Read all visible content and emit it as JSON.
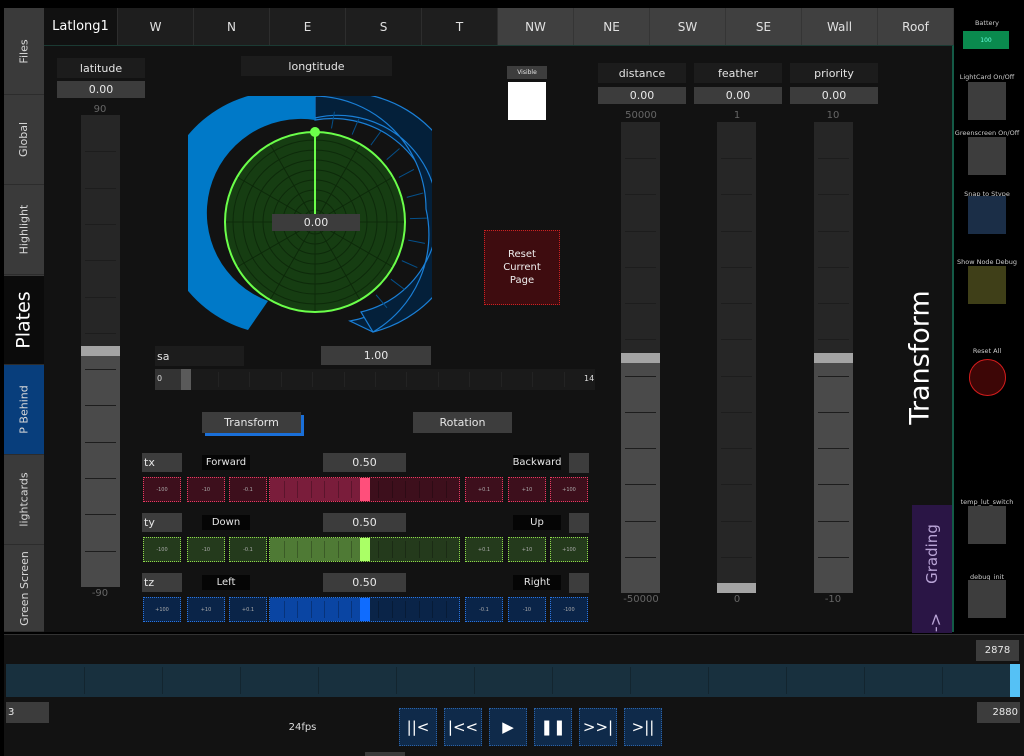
{
  "sidebar": {
    "tabs": [
      {
        "label": "Files"
      },
      {
        "label": "Global"
      },
      {
        "label": "Highlight"
      },
      {
        "label": "Plates",
        "selected": true
      },
      {
        "label": "P Behind",
        "active": true
      },
      {
        "label": "lightcards"
      },
      {
        "label": "Green Screen"
      }
    ]
  },
  "tabs": [
    {
      "label": "Latlong1",
      "selected": true
    },
    {
      "label": "W"
    },
    {
      "label": "N"
    },
    {
      "label": "E"
    },
    {
      "label": "S"
    },
    {
      "label": "T"
    },
    {
      "label": "NW"
    },
    {
      "label": "NE"
    },
    {
      "label": "SW"
    },
    {
      "label": "SE"
    },
    {
      "label": "Wall"
    },
    {
      "label": "Roof"
    }
  ],
  "latitude": {
    "label": "latitude",
    "value": "0.00",
    "max": "90",
    "min": "-90",
    "fraction": 0.5
  },
  "longitude": {
    "label": "longtitude",
    "value": "0.00",
    "angle_deg": 0
  },
  "visible": {
    "label": "Visible",
    "checked": true
  },
  "reset_page": {
    "label": "Reset Current Page",
    "line1": "Reset",
    "line2": "Current",
    "line3": "Page"
  },
  "sliders": [
    {
      "label": "distance",
      "value": "0.00",
      "max": "50000",
      "min": "-50000",
      "fraction": 0.5
    },
    {
      "label": "feather",
      "value": "0.00",
      "max": "1",
      "min": "0",
      "fraction": 0.0
    },
    {
      "label": "priority",
      "value": "0.00",
      "max": "10",
      "min": "-10",
      "fraction": 0.5
    }
  ],
  "sa": {
    "label": "sa",
    "value": "1.00",
    "min": "0",
    "max": "14",
    "fraction": 0.07
  },
  "mode_buttons": {
    "transform": "Transform",
    "rotation": "Rotation"
  },
  "axes": [
    {
      "name": "tx",
      "neg_label": "Forward",
      "pos_label": "Backward",
      "value": "0.50",
      "fraction": 0.5,
      "left_steps": [
        "-100",
        "-10",
        "-0.1"
      ],
      "right_steps": [
        "+0.1",
        "+10",
        "+100"
      ],
      "color_dark": "#3d0f1c",
      "color_fill": "#7a1d3b",
      "color_thumb": "#ff4f7b",
      "color_corner": "#e83a62"
    },
    {
      "name": "ty",
      "neg_label": "Down",
      "pos_label": "Up",
      "value": "0.50",
      "fraction": 0.5,
      "left_steps": [
        "-100",
        "-10",
        "-0.1"
      ],
      "right_steps": [
        "+0.1",
        "+10",
        "+100"
      ],
      "color_dark": "#243a1c",
      "color_fill": "#4f7a35",
      "color_thumb": "#aaff66",
      "color_corner": "#8fdc4a"
    },
    {
      "name": "tz",
      "neg_label": "Left",
      "pos_label": "Right",
      "value": "0.50",
      "fraction": 0.5,
      "left_steps": [
        "+100",
        "+10",
        "+0.1"
      ],
      "right_steps": [
        "-0.1",
        "-10",
        "-100"
      ],
      "color_dark": "#0a2448",
      "color_fill": "#0a45a3",
      "color_thumb": "#0f6cff",
      "color_corner": "#2a74e0"
    }
  ],
  "section_title": "Transform",
  "grading": {
    "label": "Grading",
    "arrow": "->"
  },
  "right_panel": {
    "battery": {
      "label": "Battery",
      "value": "100"
    },
    "lightcard": {
      "label": "LightCard On/Off"
    },
    "greenscreen": {
      "label": "Greenscreen On/Off"
    },
    "snap": {
      "label": "Snap to Stype"
    },
    "node_debug": {
      "label": "Show Node Debug"
    },
    "reset_all": {
      "label": "Reset All"
    },
    "temp_lut": {
      "label": "temp_lut_switch"
    },
    "debug_init": {
      "label": "debug_init"
    }
  },
  "timeline": {
    "current": "2878",
    "start": "3",
    "end": "2880",
    "fps": "24fps",
    "fraction": 0.999,
    "controls": [
      {
        "name": "go-start",
        "glyph": "||<"
      },
      {
        "name": "step-back",
        "glyph": "|<<"
      },
      {
        "name": "play",
        "glyph": "▶"
      },
      {
        "name": "pause",
        "glyph": "❚❚"
      },
      {
        "name": "step-forward",
        "glyph": ">>|"
      },
      {
        "name": "go-end",
        "glyph": ">||"
      }
    ]
  }
}
